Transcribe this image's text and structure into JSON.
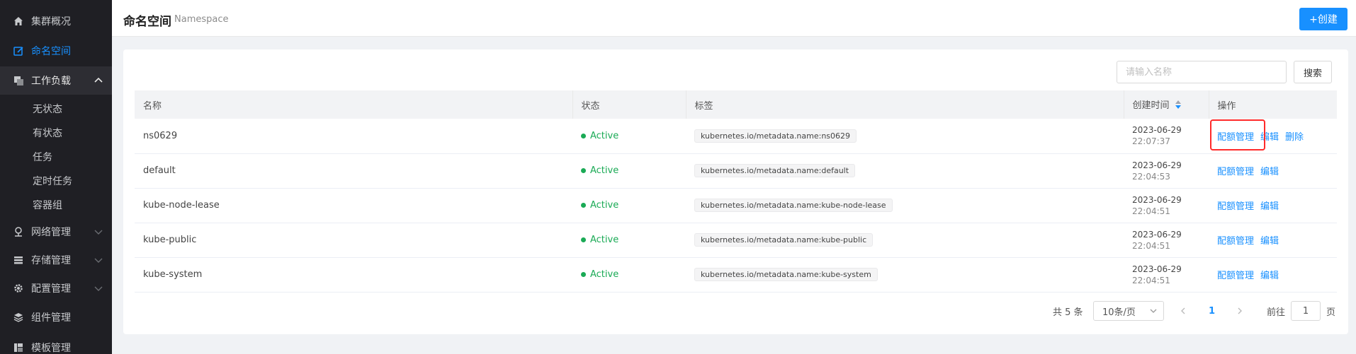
{
  "sidebar": {
    "items": [
      {
        "label": "集群概况",
        "icon": "home-icon"
      },
      {
        "label": "命名空间",
        "icon": "edit-icon",
        "active": true
      },
      {
        "label": "工作负载",
        "icon": "layers-icon",
        "open": true
      }
    ],
    "subitems": [
      "无状态",
      "有状态",
      "任务",
      "定时任务",
      "容器组"
    ],
    "more": [
      {
        "label": "网络管理",
        "icon": "network-icon"
      },
      {
        "label": "存储管理",
        "icon": "storage-icon"
      },
      {
        "label": "配置管理",
        "icon": "gear-icon"
      },
      {
        "label": "组件管理",
        "icon": "stack-icon"
      },
      {
        "label": "模板管理",
        "icon": "template-icon"
      }
    ],
    "colors": {
      "bg": "#1f1f24",
      "active": "#1890ff"
    }
  },
  "header": {
    "title": "命名空间",
    "subtitle": "Namespace",
    "create_label": "+创建"
  },
  "search": {
    "placeholder": "请输入名称",
    "button": "搜索"
  },
  "table": {
    "columns": [
      "名称",
      "状态",
      "标签",
      "创建时间",
      "操作"
    ],
    "rows": [
      {
        "name": "ns0629",
        "status": "Active",
        "label": "kubernetes.io/metadata.name:ns0629",
        "date": "2023-06-29",
        "time": "22:07:37",
        "ops": [
          "配额管理",
          "编辑",
          "删除"
        ]
      },
      {
        "name": "default",
        "status": "Active",
        "label": "kubernetes.io/metadata.name:default",
        "date": "2023-06-29",
        "time": "22:04:53",
        "ops": [
          "配额管理",
          "编辑"
        ]
      },
      {
        "name": "kube-node-lease",
        "status": "Active",
        "label": "kubernetes.io/metadata.name:kube-node-lease",
        "date": "2023-06-29",
        "time": "22:04:51",
        "ops": [
          "配额管理",
          "编辑"
        ]
      },
      {
        "name": "kube-public",
        "status": "Active",
        "label": "kubernetes.io/metadata.name:kube-public",
        "date": "2023-06-29",
        "time": "22:04:51",
        "ops": [
          "配额管理",
          "编辑"
        ]
      },
      {
        "name": "kube-system",
        "status": "Active",
        "label": "kubernetes.io/metadata.name:kube-system",
        "date": "2023-06-29",
        "time": "22:04:51",
        "ops": [
          "配额管理",
          "编辑"
        ]
      }
    ]
  },
  "pagination": {
    "total": "共 5 条",
    "page_size": "10条/页",
    "current": "1",
    "goto_label": "前往",
    "goto_value": "1",
    "unit": "页"
  },
  "colors": {
    "accent": "#1890ff",
    "active_status": "#1aaa55",
    "highlight": "#ff2a2a"
  }
}
